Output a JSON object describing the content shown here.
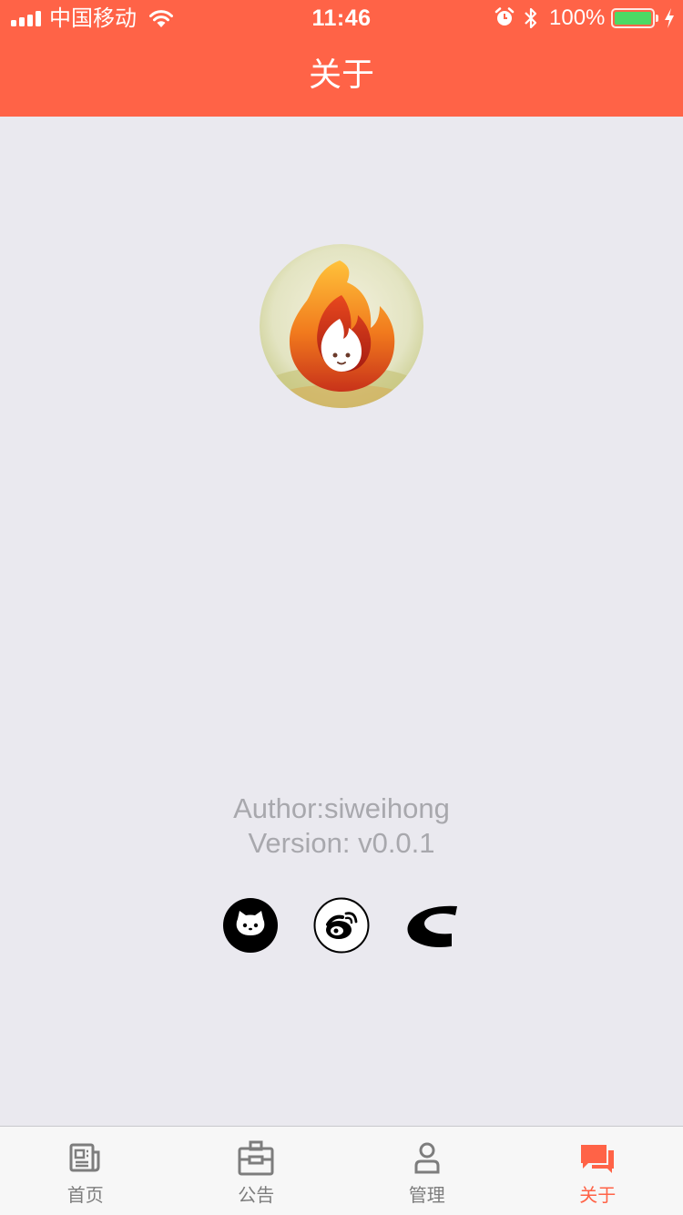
{
  "status_bar": {
    "carrier": "中国移动",
    "time": "11:46",
    "battery_percent": "100%",
    "battery_level": 1.0,
    "battery_color": "#4CD964"
  },
  "header": {
    "title": "关于",
    "background": "#FF6347"
  },
  "profile": {
    "logo_icon": "fire-mascot-logo",
    "author": "Author:siweihong",
    "version": "Version: v0.0.1"
  },
  "social_links": [
    {
      "icon": "github-icon"
    },
    {
      "icon": "weibo-icon"
    },
    {
      "icon": "csdn-icon"
    }
  ],
  "tabbar": {
    "active_color": "#FF6347",
    "inactive_color": "#7D7D7D",
    "tabs": [
      {
        "label": "首页",
        "icon": "news-icon",
        "active": false
      },
      {
        "label": "公告",
        "icon": "briefcase-icon",
        "active": false
      },
      {
        "label": "管理",
        "icon": "person-icon",
        "active": false
      },
      {
        "label": "关于",
        "icon": "chat-bubbles-icon",
        "active": true
      }
    ]
  }
}
